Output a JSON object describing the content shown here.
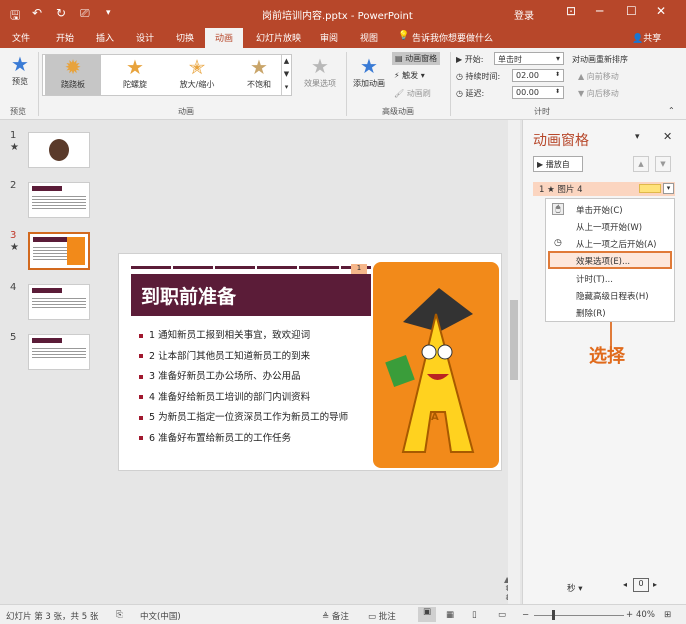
{
  "titlebar": {
    "title": "岗前培训内容.pptx - PowerPoint",
    "login": "登录",
    "accent": "#b7472a"
  },
  "tabs": {
    "items": [
      "文件",
      "开始",
      "插入",
      "设计",
      "切换",
      "动画",
      "幻灯片放映",
      "审阅",
      "视图"
    ],
    "active": "动画",
    "tell_me": "告诉我你想要做什么",
    "share": "共享"
  },
  "ribbon": {
    "preview_label": "预览",
    "preview_group": "预览",
    "animation_group": "动画",
    "effects": [
      {
        "label": "跷跷板",
        "selected": true
      },
      {
        "label": "陀螺旋",
        "selected": false
      },
      {
        "label": "放大/缩小",
        "selected": false
      },
      {
        "label": "不饱和",
        "selected": false
      }
    ],
    "effect_options": "效果选项",
    "add_animation": "添加动画",
    "animation_pane": "动画窗格",
    "trigger": "触发",
    "animation_painter": "动画刷",
    "advanced_group": "高级动画",
    "start_label": "开始:",
    "start_value": "单击时",
    "duration_label": "持续时间:",
    "duration_value": "02.00",
    "delay_label": "延迟:",
    "delay_value": "00.00",
    "reorder_label": "对动画重新排序",
    "move_earlier": "向前移动",
    "move_later": "向后移动",
    "timing_group": "计时"
  },
  "thumbnails": [
    {
      "num": "1",
      "star": "★"
    },
    {
      "num": "2",
      "star": ""
    },
    {
      "num": "3",
      "star": "★"
    },
    {
      "num": "4",
      "star": ""
    },
    {
      "num": "5",
      "star": ""
    }
  ],
  "slide": {
    "badge": "1",
    "title": "到职前准备",
    "bullets": [
      "1 通知新员工报到相关事宜，致欢迎词",
      "2 让本部门其他员工知道新员工的到来",
      "3 准备好新员工办公场所、办公用品",
      "4 准备好给新员工培训的部门内训资料",
      "5 为新员工指定一位资深员工作为新员工的导师",
      "6 准备好布置给新员工的工作任务"
    ],
    "picture_letter": "A"
  },
  "pane": {
    "title": "动画窗格",
    "play_button": "播放自",
    "item": "1 ★ 图片 4",
    "menu": [
      "单击开始(C)",
      "从上一项开始(W)",
      "从上一项之后开始(A)",
      "效果选项(E)...",
      "计时(T)...",
      "隐藏高级日程表(H)",
      "删除(R)"
    ],
    "highlighted": "效果选项(E)...",
    "annotation": "选择",
    "seconds_label": "秒",
    "timeline_value": "0"
  },
  "status": {
    "slide_info": "幻灯片 第 3 张，共 5 张",
    "language": "中文(中国)",
    "notes": "备注",
    "comments": "批注",
    "zoom": "40%"
  }
}
